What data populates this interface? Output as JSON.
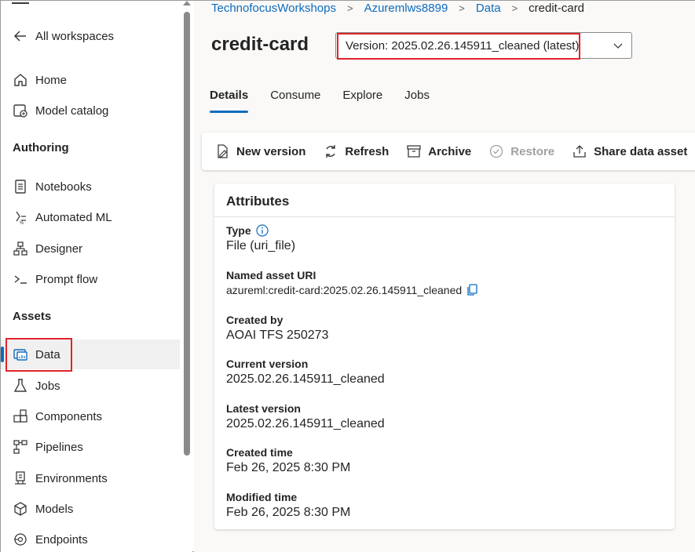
{
  "sidebar": {
    "back_label": "All workspaces",
    "items_top": [
      {
        "label": "Home",
        "icon": "home-icon"
      },
      {
        "label": "Model catalog",
        "icon": "model-catalog-icon"
      }
    ],
    "section_authoring": "Authoring",
    "authoring_items": [
      {
        "label": "Notebooks",
        "icon": "notebook-icon"
      },
      {
        "label": "Automated ML",
        "icon": "automated-ml-icon"
      },
      {
        "label": "Designer",
        "icon": "designer-icon"
      },
      {
        "label": "Prompt flow",
        "icon": "prompt-flow-icon"
      }
    ],
    "section_assets": "Assets",
    "asset_items": [
      {
        "label": "Data",
        "icon": "data-icon",
        "selected": true
      },
      {
        "label": "Jobs",
        "icon": "jobs-icon"
      },
      {
        "label": "Components",
        "icon": "components-icon"
      },
      {
        "label": "Pipelines",
        "icon": "pipelines-icon"
      },
      {
        "label": "Environments",
        "icon": "environments-icon"
      },
      {
        "label": "Models",
        "icon": "models-icon"
      },
      {
        "label": "Endpoints",
        "icon": "endpoints-icon"
      }
    ]
  },
  "breadcrumb": {
    "items": [
      "TechnofocusWorkshops",
      "Azuremlws8899",
      "Data"
    ],
    "current": "credit-card"
  },
  "page": {
    "title": "credit-card",
    "version_select": "Version: 2025.02.26.145911_cleaned (latest)"
  },
  "tabs": [
    {
      "label": "Details",
      "active": true
    },
    {
      "label": "Consume"
    },
    {
      "label": "Explore"
    },
    {
      "label": "Jobs"
    }
  ],
  "toolbar": {
    "new_version": "New version",
    "refresh": "Refresh",
    "archive": "Archive",
    "restore": "Restore",
    "share": "Share data asset"
  },
  "attributes": {
    "title": "Attributes",
    "type_label": "Type",
    "type_value": "File (uri_file)",
    "uri_label": "Named asset URI",
    "uri_value": "azureml:credit-card:2025.02.26.145911_cleaned",
    "created_by_label": "Created by",
    "created_by_value": "AOAI TFS 250273",
    "current_version_label": "Current version",
    "current_version_value": "2025.02.26.145911_cleaned",
    "latest_version_label": "Latest version",
    "latest_version_value": "2025.02.26.145911_cleaned",
    "created_time_label": "Created time",
    "created_time_value": "Feb 26, 2025 8:30 PM",
    "modified_time_label": "Modified time",
    "modified_time_value": "Feb 26, 2025 8:30 PM"
  },
  "colors": {
    "accent": "#0f6cbd",
    "highlight": "#e0242b"
  }
}
